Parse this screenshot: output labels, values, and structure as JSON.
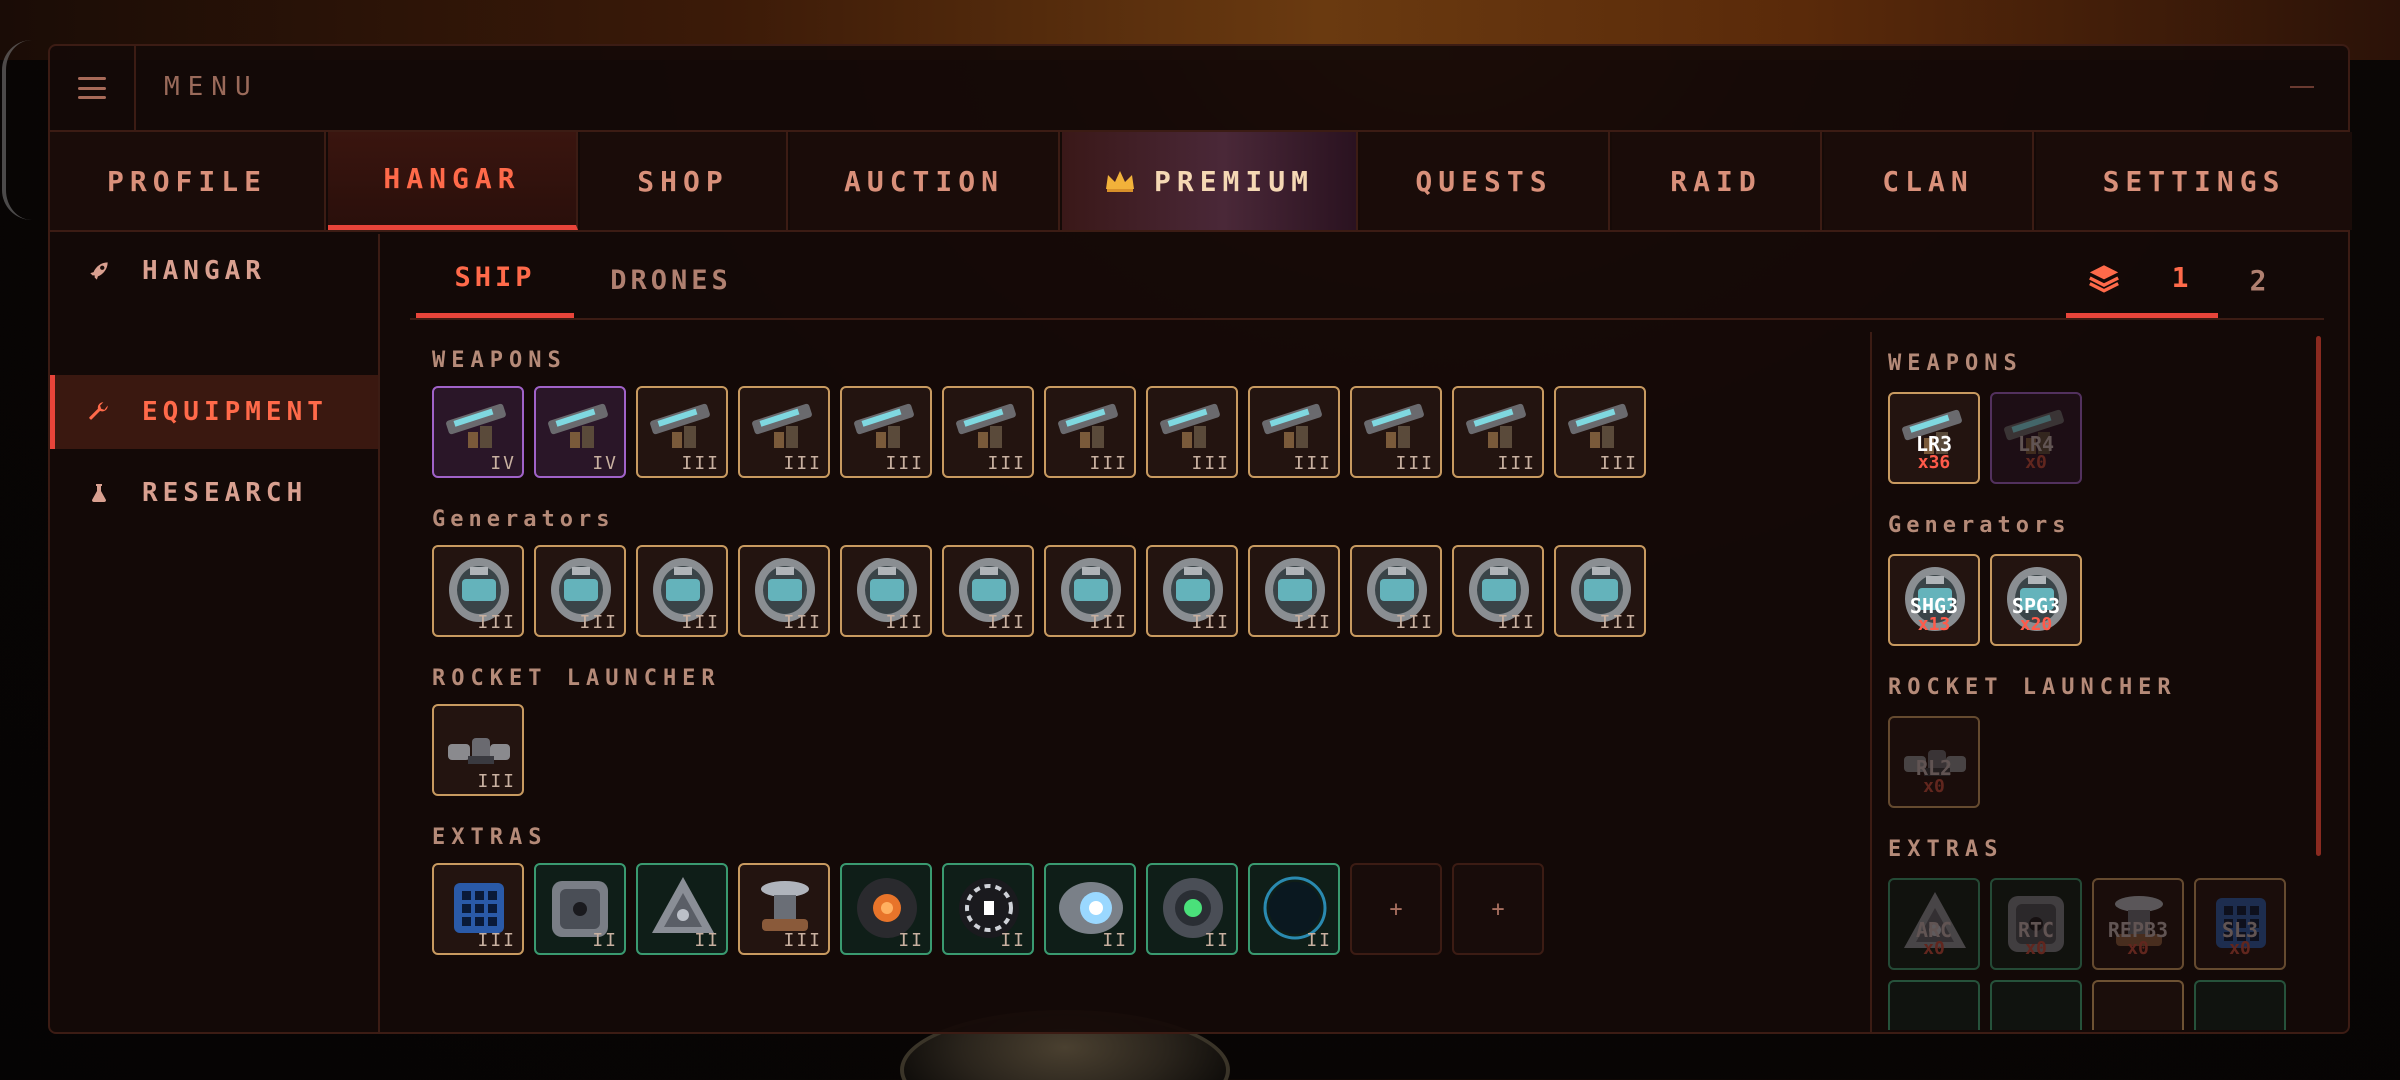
{
  "menu": {
    "label": "MENU"
  },
  "tabs": {
    "profile": "PROFILE",
    "hangar": "HANGAR",
    "shop": "SHOP",
    "auction": "AUCTION",
    "premium": "PREMIUM",
    "quests": "QUESTS",
    "raid": "RAID",
    "clan": "CLAN",
    "settings": "SETTINGS"
  },
  "sidenav": {
    "hangar": "HANGAR",
    "equipment": "EQUIPMENT",
    "research": "RESEARCH"
  },
  "subtabs": {
    "ship": "SHIP",
    "drones": "DRONES"
  },
  "configs": [
    "1",
    "2"
  ],
  "loadout": {
    "weapons_title": "WEAPONS",
    "weapons_tiers": [
      "IV",
      "IV",
      "III",
      "III",
      "III",
      "III",
      "III",
      "III",
      "III",
      "III",
      "III",
      "III"
    ],
    "generators_title": "Generators",
    "generators_tiers": [
      "III",
      "III",
      "III",
      "III",
      "III",
      "III",
      "III",
      "III",
      "III",
      "III",
      "III",
      "III"
    ],
    "rocket_title": "ROCKET LAUNCHER",
    "rocket_tiers": [
      "III"
    ],
    "extras_title": "EXTRAS",
    "extras_tiers": [
      "III",
      "II",
      "II",
      "III",
      "II",
      "II",
      "II",
      "II",
      "II"
    ],
    "extras_empty": [
      "+",
      "+"
    ]
  },
  "inventory": {
    "weapons_title": "WEAPONS",
    "weapons": [
      {
        "code": "LR3",
        "count": "x36"
      },
      {
        "code": "LR4",
        "count": "x0"
      }
    ],
    "generators_title": "Generators",
    "generators": [
      {
        "code": "SHG3",
        "count": "x13"
      },
      {
        "code": "SPG3",
        "count": "x20"
      }
    ],
    "rocket_title": "ROCKET LAUNCHER",
    "rockets": [
      {
        "code": "RL2",
        "count": "x0"
      }
    ],
    "extras_title": "EXTRAS",
    "extras": [
      {
        "code": "ARC",
        "count": "x0"
      },
      {
        "code": "RTC",
        "count": "x0"
      },
      {
        "code": "REPB3",
        "count": "x0"
      },
      {
        "code": "SL3",
        "count": "x0"
      }
    ]
  },
  "colors": {
    "accent": "#e8443a",
    "rare_border": "#c89a60",
    "epic_border": "#a062c8",
    "uncommon_border": "#3a9a70"
  }
}
